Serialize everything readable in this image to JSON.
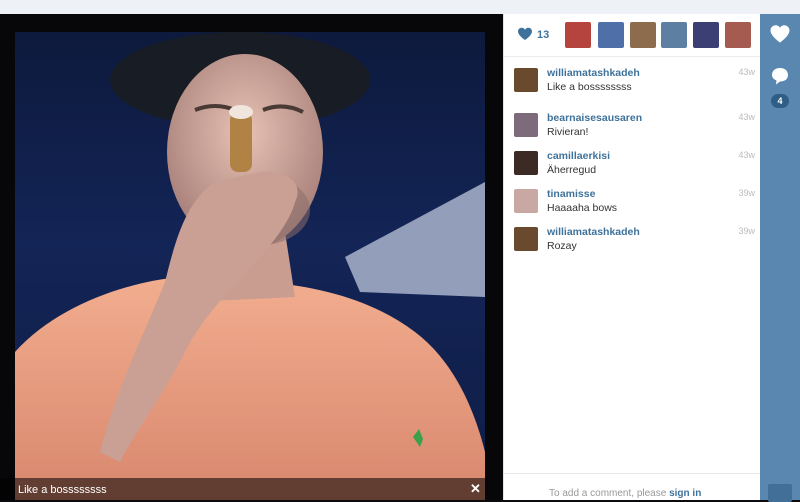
{
  "photo": {
    "caption": "Like a bossssssss",
    "close_icon": "close-icon"
  },
  "likes": {
    "count": "13",
    "likers": [
      {
        "color": "#b5443f"
      },
      {
        "color": "#4e6fa7"
      },
      {
        "color": "#8d6b4d"
      },
      {
        "color": "#5d7fa1"
      },
      {
        "color": "#3b3f73"
      },
      {
        "color": "#a55b4f"
      }
    ]
  },
  "comments": [
    {
      "user": "williamatashkadeh",
      "text": "Like a bossssssss",
      "time": "43w",
      "avatar_color": "#6a4a2c"
    },
    {
      "user": "bearnaisesausaren",
      "text": "Rivieran!",
      "time": "43w",
      "avatar_color": "#7d6a7b"
    },
    {
      "user": "camillaerkisi",
      "text": "Äherregud",
      "time": "43w",
      "avatar_color": "#3c2a24"
    },
    {
      "user": "tinamisse",
      "text": "Haaaaha bows",
      "time": "39w",
      "avatar_color": "#c9a7a2"
    },
    {
      "user": "williamatashkadeh",
      "text": "Rozay",
      "time": "39w",
      "avatar_color": "#6a4a2c"
    }
  ],
  "comment_box": {
    "prompt": "To add a comment, please",
    "sign_in": "sign in"
  },
  "sidebar": {
    "comment_count": "4"
  },
  "colors": {
    "accent": "#3f729b",
    "sidebar": "#5a87b0",
    "shirt": "#e79e7e"
  }
}
